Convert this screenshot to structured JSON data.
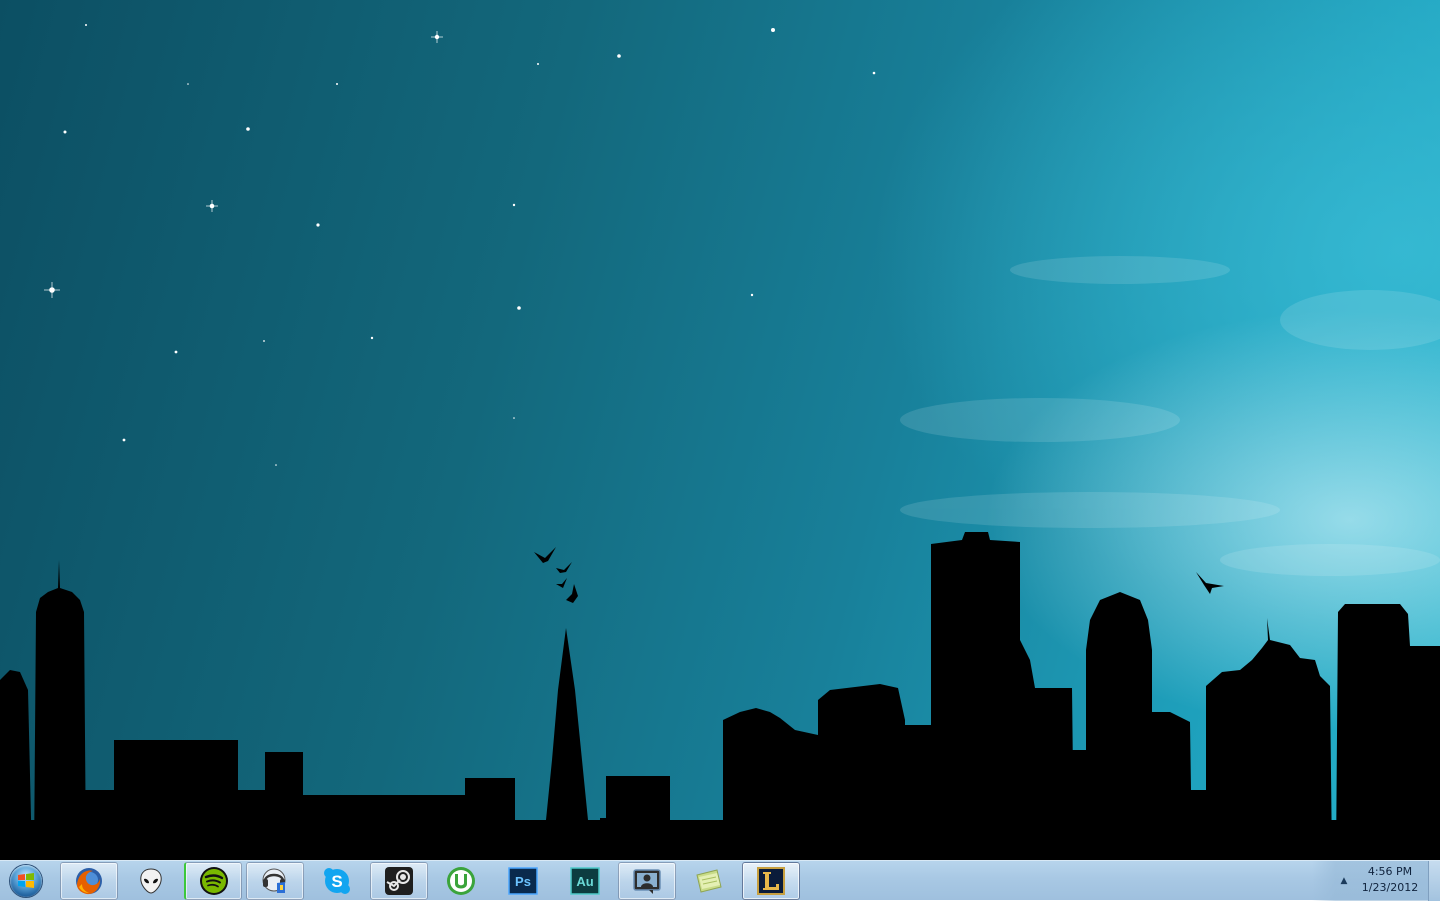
{
  "desktop": {
    "wallpaper": "city-skyline-night-wallpaper",
    "sky_colors": [
      "#0c4f63",
      "#18809a",
      "#27b3cb"
    ]
  },
  "taskbar": {
    "start_button": {
      "icon": "windows-logo-icon"
    },
    "pinned_apps": [
      {
        "name": "Firefox",
        "icon": "firefox-icon",
        "state": "running"
      },
      {
        "name": "foobar2000",
        "icon": "foobar-alien-icon",
        "state": "idle"
      },
      {
        "name": "Spotify",
        "icon": "spotify-icon",
        "state": "running"
      },
      {
        "name": "Help and Support",
        "icon": "support-headset-icon",
        "state": "running"
      },
      {
        "name": "Skype",
        "icon": "skype-icon",
        "state": "idle"
      },
      {
        "name": "Steam",
        "icon": "steam-icon",
        "state": "running"
      },
      {
        "name": "uTorrent",
        "icon": "utorrent-icon",
        "state": "idle"
      },
      {
        "name": "Photoshop",
        "icon": "photoshop-icon",
        "state": "idle"
      },
      {
        "name": "Audition",
        "icon": "audition-icon",
        "state": "idle"
      },
      {
        "name": "Windows Live Messenger",
        "icon": "messenger-icon",
        "state": "running"
      },
      {
        "name": "Sticky Notes",
        "icon": "sticky-notes-icon",
        "state": "idle"
      },
      {
        "name": "League of Legends",
        "icon": "league-of-legends-icon",
        "state": "active"
      }
    ],
    "clock": {
      "time": "4:56 PM",
      "date": "1/23/2012"
    },
    "tray_overflow_glyph": "▲"
  },
  "colors": {
    "taskbar": "#a8c8e4",
    "skyline": "#000000"
  }
}
